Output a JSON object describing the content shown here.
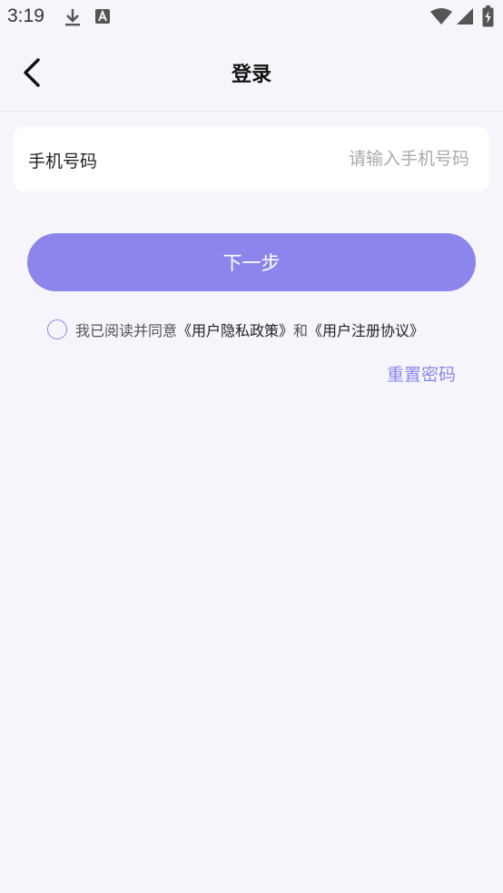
{
  "status_bar": {
    "time": "3:19",
    "icons": [
      "download-icon",
      "text-a-icon",
      "wifi-icon",
      "signal-icon",
      "battery-charging-icon"
    ]
  },
  "header": {
    "title": "登录",
    "back_icon": "chevron-left-icon"
  },
  "form": {
    "phone_label": "手机号码",
    "phone_value": "",
    "phone_placeholder": "请输入手机号码",
    "next_label": "下一步"
  },
  "agreement": {
    "checked": false,
    "prefix": "我已阅读并同意",
    "privacy_link": "《用户隐私政策》",
    "conjunction": "和",
    "terms_link": "《用户注册协议》"
  },
  "reset_password_label": "重置密码",
  "colors": {
    "accent": "#8c86ec",
    "background": "#f5f5fb",
    "card": "#ffffff",
    "title": "#111111",
    "placeholder": "#a8a8b0"
  }
}
